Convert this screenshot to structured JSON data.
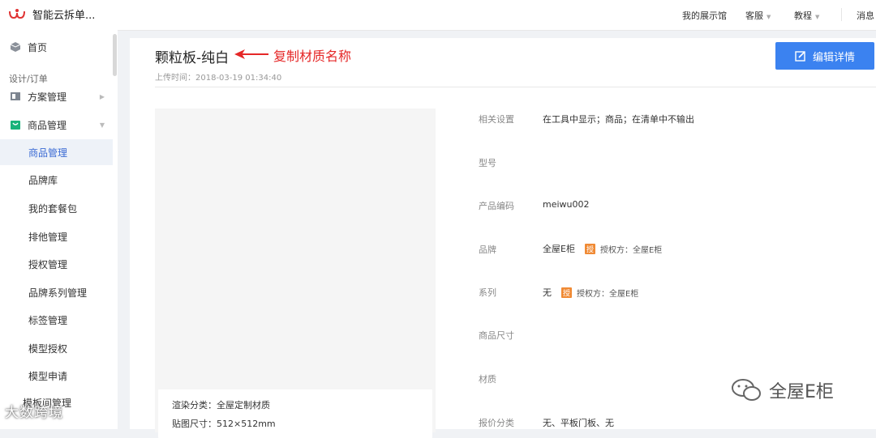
{
  "app": {
    "name": "智能云拆单..."
  },
  "sidebar": {
    "home": "首页",
    "group_title": "设计/订单",
    "items": [
      {
        "label": "方案管理"
      },
      {
        "label": "商品管理"
      }
    ],
    "sub_items": [
      {
        "label": "商品管理",
        "active": true
      },
      {
        "label": "品牌库"
      },
      {
        "label": "我的套餐包"
      },
      {
        "label": "排他管理"
      },
      {
        "label": "授权管理"
      },
      {
        "label": "品牌系列管理"
      },
      {
        "label": "标签管理"
      },
      {
        "label": "模型授权"
      },
      {
        "label": "模型申请"
      }
    ],
    "obscured": "模板间管理"
  },
  "topbar": {
    "links": [
      {
        "label": "我的展示馆"
      },
      {
        "label": "客服"
      },
      {
        "label": "教程"
      },
      {
        "label": "消息"
      }
    ]
  },
  "detail": {
    "title": "颗粒板-纯白",
    "upload_time": "上传时间：2018-03-19 01:34:40",
    "annotation": "复制材质名称",
    "edit_button": "编辑详情",
    "image_info": {
      "render_category": "渲染分类：全屋定制材质",
      "texture_size": "贴图尺寸：512×512mm"
    },
    "properties": [
      {
        "label": "相关设置",
        "value": "在工具中显示；商品；在清单中不输出"
      },
      {
        "label": "型号",
        "value": ""
      },
      {
        "label": "产品编码",
        "value": "meiwu002"
      },
      {
        "label": "品牌",
        "value": "全屋E柜",
        "badge": "授",
        "auth": "授权方：全屋E柜"
      },
      {
        "label": "系列",
        "value": "无",
        "badge": "授",
        "auth": "授权方：全屋E柜"
      },
      {
        "label": "商品尺寸",
        "value": ""
      },
      {
        "label": "材质",
        "value": ""
      },
      {
        "label": "报价分类",
        "value": "无、平板门板、无"
      }
    ]
  },
  "watermarks": {
    "left": "大数跨境",
    "right": "全屋E柜"
  },
  "colors": {
    "primary": "#3b82f0",
    "annotation": "#e52727",
    "badge": "#f08a34"
  }
}
